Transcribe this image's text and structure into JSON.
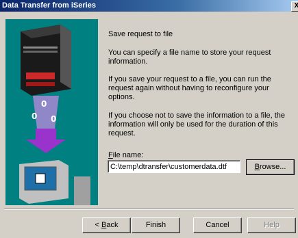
{
  "window": {
    "title": "Data Transfer from iSeries",
    "close_label": "X"
  },
  "main": {
    "heading": "Save request to file",
    "p1": "You can specify a file name to store your request information.",
    "p2": "If you save your request to a file, you can run the request again without having to reconfigure your options.",
    "p3": "If you choose not to save the information to a file, the information will only be used for the duration of this request.",
    "file_label_accel": "F",
    "file_label_rest": "ile name:",
    "file_value": "C:\\temp\\dtransfer\\customerdata.dtf",
    "browse_accel": "B",
    "browse_rest": "rowse..."
  },
  "footer": {
    "back_prefix": "< ",
    "back_accel": "B",
    "back_rest": "ack",
    "finish": "Finish",
    "cancel": "Cancel",
    "help": "Help"
  },
  "art": {
    "bg": "#008080",
    "server": "#1a1a1a",
    "stripe": "#cc2a2a",
    "arrow": "#9933cc",
    "monitor": "#c0c0c0"
  }
}
